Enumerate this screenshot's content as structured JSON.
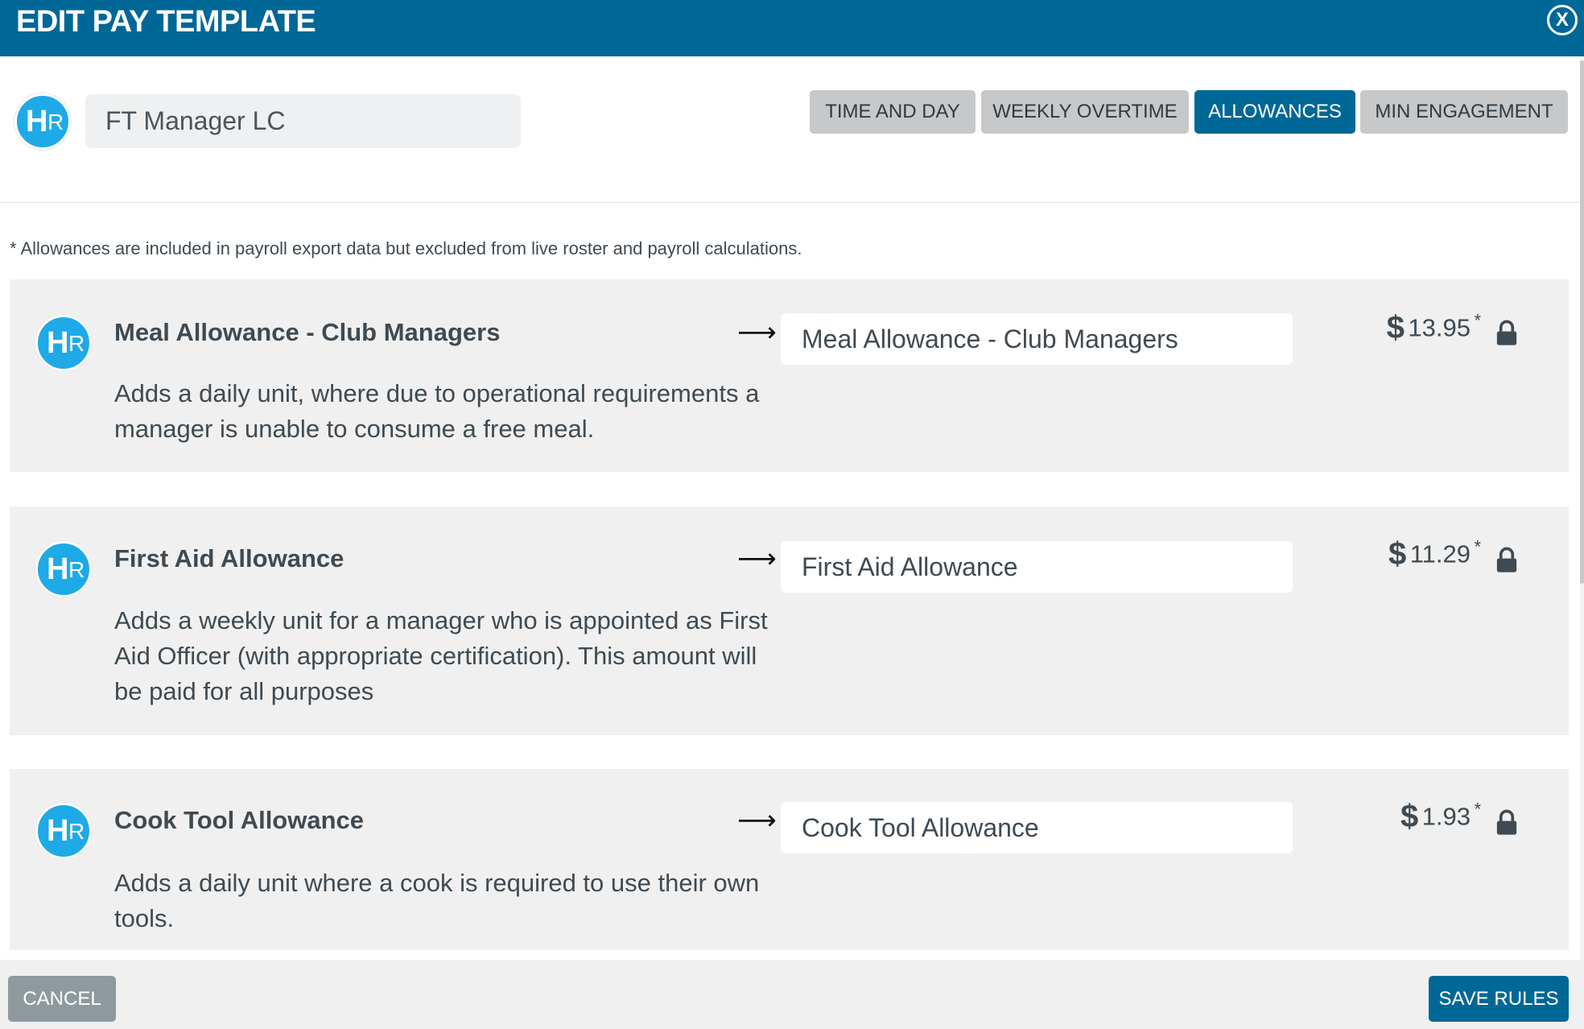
{
  "header": {
    "title": "EDIT PAY TEMPLATE",
    "close_label": "X"
  },
  "logo": {
    "h": "H",
    "r": "R"
  },
  "template": {
    "name": "FT Manager LC"
  },
  "tabs": [
    {
      "label": "TIME AND DAY",
      "active": false
    },
    {
      "label": "WEEKLY OVERTIME",
      "active": false
    },
    {
      "label": "ALLOWANCES",
      "active": true
    },
    {
      "label": "MIN ENGAGEMENT",
      "active": false
    }
  ],
  "note": "* Allowances are included in payroll export data but excluded from live roster and payroll calculations.",
  "allowances": [
    {
      "title": "Meal Allowance - Club Managers",
      "description": "Adds a daily unit, where due to operational requirements a manager is unable to consume a free meal.",
      "export_name": "Meal Allowance - Club Managers",
      "currency": "$",
      "amount": "13.95",
      "marker": "*"
    },
    {
      "title": "First Aid Allowance",
      "description": "Adds a weekly unit for a manager who is appointed as First Aid Officer (with appropriate certification). This amount will be paid for all purposes",
      "export_name": "First Aid Allowance",
      "currency": "$",
      "amount": "11.29",
      "marker": "*"
    },
    {
      "title": "Cook Tool Allowance",
      "description": "Adds a daily unit where a cook is required to use their own tools.",
      "export_name": "Cook Tool Allowance",
      "currency": "$",
      "amount": "1.93",
      "marker": "*"
    }
  ],
  "arrow": "⟶",
  "footer": {
    "cancel_label": "CANCEL",
    "save_label": "SAVE RULES"
  },
  "icons": {
    "arrow": "right-arrow-icon",
    "lock": "lock-icon",
    "close": "close-icon",
    "logo": "hr-logo-icon"
  },
  "colors": {
    "brand": "#006896",
    "logo": "#1eaae6",
    "tab_inactive": "#c7c8c9",
    "card_bg": "#f0f0f0",
    "cancel": "#8e9a9d"
  }
}
